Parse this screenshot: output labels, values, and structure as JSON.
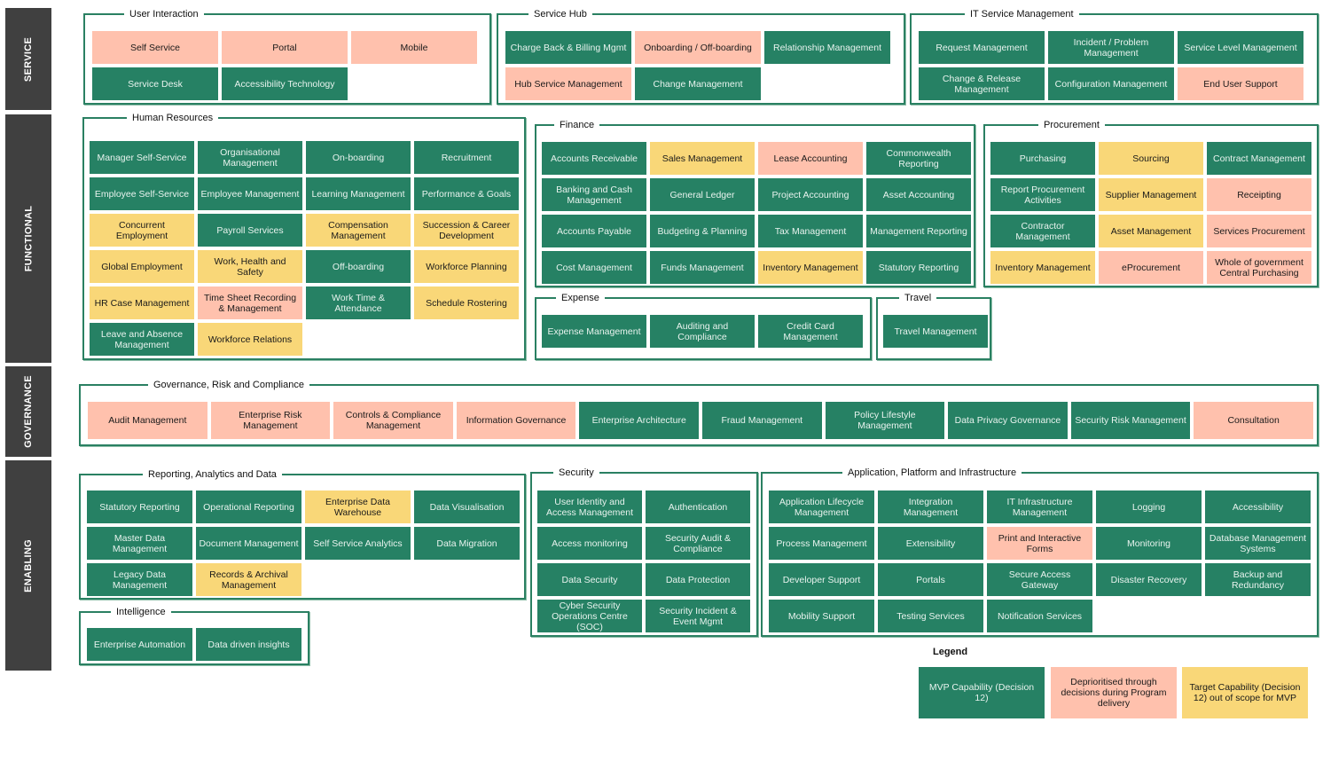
{
  "colors": {
    "mvp": "#268164",
    "deprioritised": "#ffc1ad",
    "target": "#f9d778",
    "layer_bg": "#404040",
    "border": "#2a8062"
  },
  "layers": {
    "service": "SERVICE",
    "functional": "FUNCTIONAL",
    "governance": "GOVERNANCE",
    "enabling": "ENABLING"
  },
  "groups": {
    "user_interaction": {
      "title": "User Interaction",
      "items": [
        {
          "label": "Self Service",
          "status": "dep"
        },
        {
          "label": "Portal",
          "status": "dep"
        },
        {
          "label": "Mobile",
          "status": "dep"
        },
        {
          "label": "Service Desk",
          "status": "mvp"
        },
        {
          "label": "Accessibility Technology",
          "status": "mvp"
        }
      ]
    },
    "service_hub": {
      "title": "Service Hub",
      "items": [
        {
          "label": "Charge Back & Billing Mgmt",
          "status": "mvp"
        },
        {
          "label": "Onboarding / Off-boarding",
          "status": "dep"
        },
        {
          "label": "Relationship Management",
          "status": "mvp"
        },
        {
          "label": "Hub Service Management",
          "status": "dep"
        },
        {
          "label": "Change Management",
          "status": "mvp"
        }
      ]
    },
    "it_service_management": {
      "title": "IT Service Management",
      "items": [
        {
          "label": "Request Management",
          "status": "mvp"
        },
        {
          "label": "Incident / Problem Management",
          "status": "mvp"
        },
        {
          "label": "Service Level Management",
          "status": "mvp"
        },
        {
          "label": "Change & Release Management",
          "status": "mvp"
        },
        {
          "label": "Configuration Management",
          "status": "mvp"
        },
        {
          "label": "End User Support",
          "status": "dep"
        }
      ]
    },
    "human_resources": {
      "title": "Human Resources",
      "items": [
        {
          "label": "Manager Self-Service",
          "status": "mvp"
        },
        {
          "label": "Organisational Management",
          "status": "mvp"
        },
        {
          "label": "On-boarding",
          "status": "mvp"
        },
        {
          "label": "Recruitment",
          "status": "mvp"
        },
        {
          "label": "Employee Self-Service",
          "status": "mvp"
        },
        {
          "label": "Employee Management",
          "status": "mvp"
        },
        {
          "label": "Learning Management",
          "status": "mvp"
        },
        {
          "label": "Performance & Goals",
          "status": "mvp"
        },
        {
          "label": "Concurrent Employment",
          "status": "tgt"
        },
        {
          "label": "Payroll Services",
          "status": "mvp"
        },
        {
          "label": "Compensation Management",
          "status": "tgt"
        },
        {
          "label": "Succession & Career Development",
          "status": "tgt"
        },
        {
          "label": "Global Employment",
          "status": "tgt"
        },
        {
          "label": "Work, Health and Safety",
          "status": "tgt"
        },
        {
          "label": "Off-boarding",
          "status": "mvp"
        },
        {
          "label": "Workforce Planning",
          "status": "tgt"
        },
        {
          "label": "HR Case Management",
          "status": "tgt"
        },
        {
          "label": "Time Sheet Recording & Management",
          "status": "dep"
        },
        {
          "label": "Work Time & Attendance",
          "status": "mvp"
        },
        {
          "label": "Schedule Rostering",
          "status": "tgt"
        },
        {
          "label": "Leave and Absence Management",
          "status": "mvp"
        },
        {
          "label": "Workforce Relations",
          "status": "tgt"
        }
      ]
    },
    "finance": {
      "title": "Finance",
      "items": [
        {
          "label": "Accounts Receivable",
          "status": "mvp"
        },
        {
          "label": "Sales Management",
          "status": "tgt"
        },
        {
          "label": "Lease Accounting",
          "status": "dep"
        },
        {
          "label": "Commonwealth Reporting",
          "status": "mvp"
        },
        {
          "label": "Banking and Cash Management",
          "status": "mvp"
        },
        {
          "label": "General Ledger",
          "status": "mvp"
        },
        {
          "label": "Project Accounting",
          "status": "mvp"
        },
        {
          "label": "Asset Accounting",
          "status": "mvp"
        },
        {
          "label": "Accounts Payable",
          "status": "mvp"
        },
        {
          "label": "Budgeting & Planning",
          "status": "mvp"
        },
        {
          "label": "Tax Management",
          "status": "mvp"
        },
        {
          "label": "Management Reporting",
          "status": "mvp"
        },
        {
          "label": "Cost Management",
          "status": "mvp"
        },
        {
          "label": "Funds Management",
          "status": "mvp"
        },
        {
          "label": "Inventory Management",
          "status": "tgt"
        },
        {
          "label": "Statutory Reporting",
          "status": "mvp"
        }
      ]
    },
    "procurement": {
      "title": "Procurement",
      "items": [
        {
          "label": "Purchasing",
          "status": "mvp"
        },
        {
          "label": "Sourcing",
          "status": "tgt"
        },
        {
          "label": "Contract Management",
          "status": "mvp"
        },
        {
          "label": "Report Procurement Activities",
          "status": "mvp"
        },
        {
          "label": "Supplier Management",
          "status": "tgt"
        },
        {
          "label": "Receipting",
          "status": "dep"
        },
        {
          "label": "Contractor Management",
          "status": "mvp"
        },
        {
          "label": "Asset Management",
          "status": "tgt"
        },
        {
          "label": "Services Procurement",
          "status": "dep"
        },
        {
          "label": "Inventory Management",
          "status": "tgt"
        },
        {
          "label": "eProcurement",
          "status": "dep"
        },
        {
          "label": "Whole of government Central Purchasing",
          "status": "dep"
        }
      ]
    },
    "expense": {
      "title": "Expense",
      "items": [
        {
          "label": "Expense Management",
          "status": "mvp"
        },
        {
          "label": "Auditing and Compliance",
          "status": "mvp"
        },
        {
          "label": "Credit Card Management",
          "status": "mvp"
        }
      ]
    },
    "travel": {
      "title": "Travel",
      "items": [
        {
          "label": "Travel Management",
          "status": "mvp"
        }
      ]
    },
    "grc": {
      "title": "Governance, Risk and Compliance",
      "items": [
        {
          "label": "Audit Management",
          "status": "dep"
        },
        {
          "label": "Enterprise Risk Management",
          "status": "dep"
        },
        {
          "label": "Controls & Compliance Management",
          "status": "dep"
        },
        {
          "label": "Information Governance",
          "status": "dep"
        },
        {
          "label": "Enterprise Architecture",
          "status": "mvp"
        },
        {
          "label": "Fraud Management",
          "status": "mvp"
        },
        {
          "label": "Policy Lifestyle Management",
          "status": "mvp"
        },
        {
          "label": "Data Privacy Governance",
          "status": "mvp"
        },
        {
          "label": "Security Risk Management",
          "status": "mvp"
        },
        {
          "label": "Consultation",
          "status": "dep"
        }
      ]
    },
    "reporting": {
      "title": "Reporting, Analytics and Data",
      "items": [
        {
          "label": "Statutory Reporting",
          "status": "mvp"
        },
        {
          "label": "Operational Reporting",
          "status": "mvp"
        },
        {
          "label": "Enterprise Data Warehouse",
          "status": "tgt"
        },
        {
          "label": "Data Visualisation",
          "status": "mvp"
        },
        {
          "label": "Master Data Management",
          "status": "mvp"
        },
        {
          "label": "Document Management",
          "status": "mvp"
        },
        {
          "label": "Self Service Analytics",
          "status": "mvp"
        },
        {
          "label": "Data Migration",
          "status": "mvp"
        },
        {
          "label": "Legacy Data Management",
          "status": "mvp"
        },
        {
          "label": "Records & Archival Management",
          "status": "tgt"
        }
      ]
    },
    "intelligence": {
      "title": "Intelligence",
      "items": [
        {
          "label": "Enterprise Automation",
          "status": "mvp"
        },
        {
          "label": "Data driven insights",
          "status": "mvp"
        }
      ]
    },
    "security": {
      "title": "Security",
      "items": [
        {
          "label": "User Identity and Access Management",
          "status": "mvp"
        },
        {
          "label": "Authentication",
          "status": "mvp"
        },
        {
          "label": "Access monitoring",
          "status": "mvp"
        },
        {
          "label": "Security Audit & Compliance",
          "status": "mvp"
        },
        {
          "label": "Data Security",
          "status": "mvp"
        },
        {
          "label": "Data Protection",
          "status": "mvp"
        },
        {
          "label": "Cyber Security Operations Centre (SOC)",
          "status": "mvp"
        },
        {
          "label": "Security Incident & Event Mgmt",
          "status": "mvp"
        }
      ]
    },
    "api": {
      "title": "Application, Platform and Infrastructure",
      "items": [
        {
          "label": "Application Lifecycle Management",
          "status": "mvp"
        },
        {
          "label": "Integration Management",
          "status": "mvp"
        },
        {
          "label": "IT Infrastructure Management",
          "status": "mvp"
        },
        {
          "label": "Logging",
          "status": "mvp"
        },
        {
          "label": "Accessibility",
          "status": "mvp"
        },
        {
          "label": "Process Management",
          "status": "mvp"
        },
        {
          "label": "Extensibility",
          "status": "mvp"
        },
        {
          "label": "Print and Interactive Forms",
          "status": "dep"
        },
        {
          "label": "Monitoring",
          "status": "mvp"
        },
        {
          "label": "Database Management Systems",
          "status": "mvp"
        },
        {
          "label": "Developer Support",
          "status": "mvp"
        },
        {
          "label": "Portals",
          "status": "mvp"
        },
        {
          "label": "Secure Access Gateway",
          "status": "mvp"
        },
        {
          "label": "Disaster Recovery",
          "status": "mvp"
        },
        {
          "label": "Backup and Redundancy",
          "status": "mvp"
        },
        {
          "label": "Mobility Support",
          "status": "mvp"
        },
        {
          "label": "Testing Services",
          "status": "mvp"
        },
        {
          "label": "Notification Services",
          "status": "mvp"
        }
      ]
    }
  },
  "legend": {
    "title": "Legend",
    "items": [
      {
        "label": "MVP Capability (Decision 12)",
        "status": "mvp"
      },
      {
        "label": "Deprioritised through decisions during Program delivery",
        "status": "dep"
      },
      {
        "label": "Target Capability (Decision 12) out of scope for MVP",
        "status": "tgt"
      }
    ]
  }
}
